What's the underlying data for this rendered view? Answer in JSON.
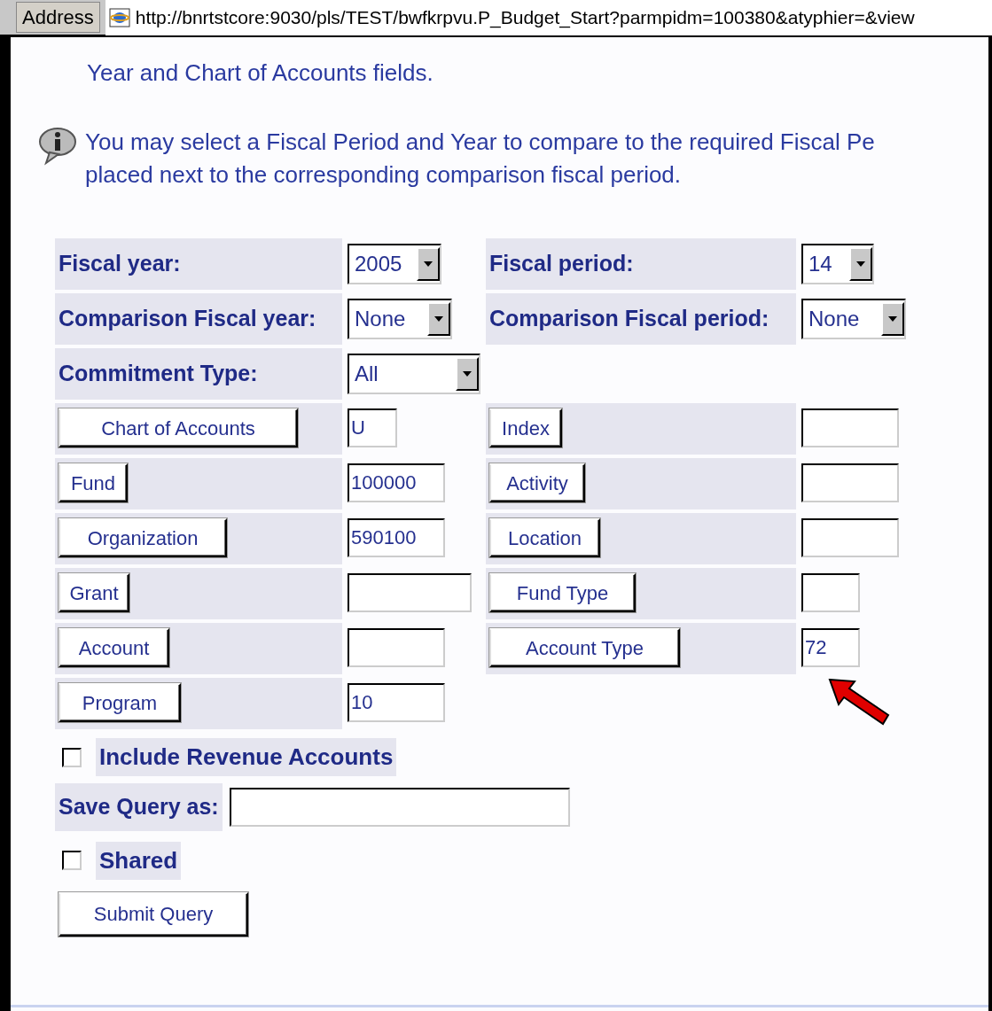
{
  "address_bar": {
    "label": "Address",
    "url": "http://bnrtstcore:9030/pls/TEST/bwfkrpvu.P_Budget_Start?parmpidm=100380&atyphier=&view"
  },
  "intro_text": "Year and Chart of Accounts fields.",
  "info_note": {
    "lines": [
      "You may select a Fiscal Period and Year to compare to the required Fiscal Pe",
      "placed next to the corresponding comparison fiscal period."
    ]
  },
  "form": {
    "rows": [
      {
        "left": {
          "kind": "label",
          "label": "Fiscal year:",
          "control": {
            "kind": "select",
            "value": "2005"
          }
        },
        "right": {
          "kind": "label",
          "label": "Fiscal period:",
          "control": {
            "kind": "select",
            "value": "14"
          }
        }
      },
      {
        "left": {
          "kind": "label",
          "label": "Comparison Fiscal year:",
          "control": {
            "kind": "select",
            "value": "None"
          }
        },
        "right": {
          "kind": "label",
          "label": "Comparison Fiscal period:",
          "control": {
            "kind": "select",
            "value": "None"
          }
        }
      },
      {
        "left": {
          "kind": "label",
          "label": "Commitment Type:",
          "control": {
            "kind": "select",
            "value": "All"
          }
        }
      },
      {
        "left": {
          "kind": "button",
          "label": "Chart of Accounts",
          "control": {
            "kind": "text",
            "value": "U"
          }
        },
        "right": {
          "kind": "button",
          "label": "Index",
          "control": {
            "kind": "text"
          }
        }
      },
      {
        "left": {
          "kind": "button",
          "label": "Fund",
          "control": {
            "kind": "text",
            "value": "100000"
          }
        },
        "right": {
          "kind": "button",
          "label": "Activity",
          "control": {
            "kind": "text"
          }
        }
      },
      {
        "left": {
          "kind": "button",
          "label": "Organization",
          "control": {
            "kind": "text",
            "value": "590100"
          }
        },
        "right": {
          "kind": "button",
          "label": "Location",
          "control": {
            "kind": "text"
          }
        }
      },
      {
        "left": {
          "kind": "button",
          "label": "Grant",
          "control": {
            "kind": "text"
          }
        },
        "right": {
          "kind": "button",
          "label": "Fund Type",
          "control": {
            "kind": "text"
          }
        }
      },
      {
        "left": {
          "kind": "button",
          "label": "Account",
          "control": {
            "kind": "text"
          }
        },
        "right": {
          "kind": "button",
          "label": "Account Type",
          "control": {
            "kind": "text",
            "value": "72"
          }
        }
      },
      {
        "left": {
          "kind": "button",
          "label": "Program",
          "control": {
            "kind": "text",
            "value": "10"
          }
        }
      }
    ]
  },
  "include_revenue": {
    "label": "Include Revenue Accounts",
    "checked": false
  },
  "save_query": {
    "label": "Save Query as:"
  },
  "shared": {
    "label": "Shared",
    "checked": false
  },
  "submit_button": "Submit Query"
}
